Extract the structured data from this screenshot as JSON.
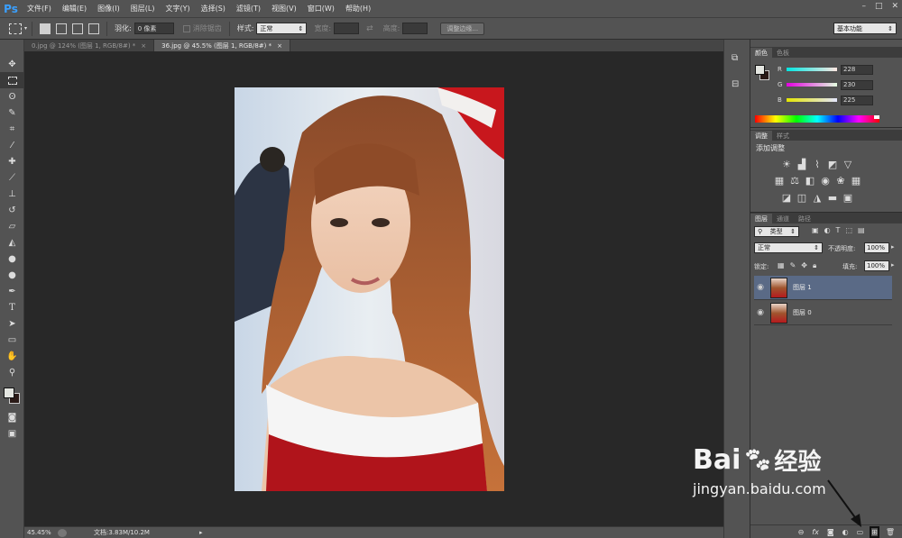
{
  "app": {
    "logo": "Ps"
  },
  "menubar": {
    "items": [
      "文件(F)",
      "编辑(E)",
      "图像(I)",
      "图层(L)",
      "文字(Y)",
      "选择(S)",
      "滤镜(T)",
      "视图(V)",
      "窗口(W)",
      "帮助(H)"
    ],
    "minimize": "–",
    "maximize": "□",
    "close": "✕"
  },
  "options": {
    "feather_label": "羽化:",
    "feather_value": "0 像素",
    "antialias_label": "消除锯齿",
    "style_label": "样式:",
    "style_value": "正常",
    "width_label": "宽度:",
    "height_label": "高度:",
    "refine_label": "调整边缘...",
    "workspace": "基本功能"
  },
  "tabs": [
    {
      "label": "0.jpg @ 124% (图层 1, RGB/8#) *",
      "close": "×"
    },
    {
      "label": "36.jpg @ 45.5% (图层 1, RGB/8#) *",
      "close": "×"
    }
  ],
  "status": {
    "zoom": "45.45%",
    "doc": "文档:3.83M/10.2M"
  },
  "color_panel": {
    "tabs": [
      "颜色",
      "色板"
    ],
    "r_label": "R",
    "g_label": "G",
    "b_label": "B",
    "r": "228",
    "g": "230",
    "b": "225",
    "foreground": "#e4e6e1",
    "background": "#2a1a17"
  },
  "adjust_panel": {
    "tabs": [
      "调整",
      "样式"
    ],
    "title": "添加调整"
  },
  "layers_panel": {
    "tabs": [
      "图层",
      "通道",
      "路径"
    ],
    "filter": "类型",
    "blend": "正常",
    "opacity_label": "不透明度:",
    "opacity": "100%",
    "lock_label": "锁定:",
    "fill_label": "填充:",
    "fill": "100%",
    "layers": [
      {
        "name": "图层 1",
        "selected": true
      },
      {
        "name": "图层 0",
        "selected": false
      }
    ],
    "footer_fx": "fx"
  },
  "watermark": {
    "brand": "Bai",
    "brand2": "经验",
    "url": "jingyan.baidu.com"
  },
  "colors": {
    "accent_blue": "#3aa0ff",
    "selected_layer": "#5a6a86",
    "canvas_bg": "#282828",
    "panel_bg": "#535353"
  }
}
